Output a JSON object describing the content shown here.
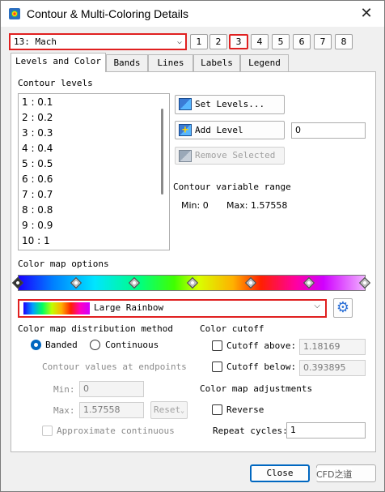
{
  "window": {
    "title": "Contour & Multi-Coloring Details",
    "close_glyph": "✕"
  },
  "variable": {
    "selected": "13: Mach"
  },
  "group_buttons": [
    "1",
    "2",
    "3",
    "4",
    "5",
    "6",
    "7",
    "8"
  ],
  "tabs": [
    "Levels and Color",
    "Bands",
    "Lines",
    "Labels",
    "Legend"
  ],
  "levels": {
    "heading": "Contour levels",
    "items": [
      "1 : 0.1",
      "2 : 0.2",
      "3 : 0.3",
      "4 : 0.4",
      "5 : 0.5",
      "6 : 0.6",
      "7 : 0.7",
      "8 : 0.8",
      "9 : 0.9",
      "10 : 1"
    ],
    "set_levels": "Set Levels...",
    "add_level": "Add Level",
    "add_level_value": "0",
    "remove_selected": "Remove Selected",
    "range_heading": "Contour variable range",
    "min_label": "Min: 0",
    "max_label": "Max: 1.57558"
  },
  "colormap": {
    "heading": "Color map options",
    "selected": "Large Rainbow",
    "distribution_heading": "Color map distribution method",
    "banded": "Banded",
    "continuous": "Continuous",
    "endpoints_heading": "Contour values at endpoints",
    "min_label": "Min:",
    "min_value": "0",
    "max_label": "Max:",
    "max_value": "1.57558",
    "reset": "Reset",
    "approximate": "Approximate continuous"
  },
  "cutoff": {
    "heading": "Color cutoff",
    "above_label": "Cutoff above:",
    "above_value": "1.18169",
    "below_label": "Cutoff below:",
    "below_value": "0.393895"
  },
  "adjustments": {
    "heading": "Color map adjustments",
    "reverse": "Reverse",
    "repeat_label": "Repeat cycles:",
    "repeat_value": "1"
  },
  "footer": {
    "close": "Close",
    "help": "Hel"
  },
  "watermark": "CFD之道"
}
